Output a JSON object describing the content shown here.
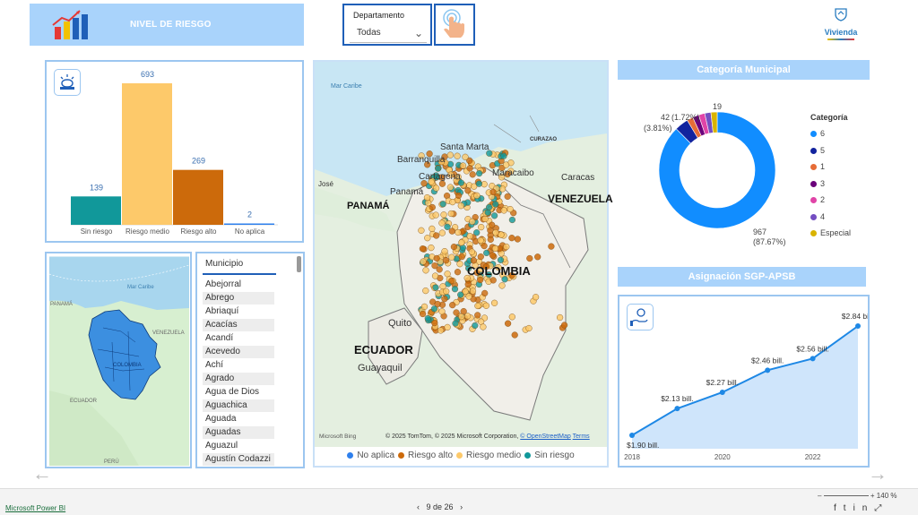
{
  "header": {
    "title": "NIVEL DE RIESGO",
    "filter_label": "Departamento",
    "filter_value": "Todas",
    "brand": "Vivienda"
  },
  "risk_chart": {
    "chart_data": {
      "type": "bar",
      "categories": [
        "Sin riesgo",
        "Riesgo medio",
        "Riesgo alto",
        "No aplica"
      ],
      "values": [
        139,
        693,
        269,
        2
      ],
      "colors": [
        "#11989a",
        "#fdc96a",
        "#cc6a0b",
        "#2f80ed"
      ]
    }
  },
  "categoria": {
    "title": "Categoría Municipal",
    "legend_title": "Categoría",
    "chart_data": {
      "type": "pie",
      "categories": [
        "6",
        "5",
        "1",
        "3",
        "2",
        "4",
        "Especial"
      ],
      "values": [
        967,
        42,
        19,
        19,
        19,
        19,
        19
      ],
      "colors": [
        "#118dff",
        "#12239e",
        "#e66c37",
        "#6b007b",
        "#e044a7",
        "#744ec2",
        "#d9b300"
      ]
    },
    "labels": {
      "big_value": "967",
      "big_pct": "(87.67%)",
      "a_value": "42",
      "a_pct": "(3.81%)",
      "b_value": "19",
      "b_pct": "(1.72%)"
    }
  },
  "sgp": {
    "title": "Asignación SGP-APSB",
    "chart_data": {
      "type": "area",
      "x": [
        2018,
        2019,
        2020,
        2021,
        2022,
        2023
      ],
      "values": [
        1.9,
        2.13,
        2.27,
        2.46,
        2.56,
        2.84
      ],
      "data_labels": [
        "$1.90 bill.",
        "$2.13 bill.",
        "$2.27 bill.",
        "$2.46 bill.",
        "$2.56 bill.",
        "$2.84 bill."
      ],
      "x_ticks": [
        "2018",
        "2020",
        "2022"
      ],
      "color": "#1e88e5"
    }
  },
  "municipios": {
    "header": "Municipio",
    "items": [
      "Abejorral",
      "Abrego",
      "Abriaquí",
      "Acacías",
      "Acandí",
      "Acevedo",
      "Achí",
      "Agrado",
      "Agua de Dios",
      "Aguachica",
      "Aguada",
      "Aguadas",
      "Aguazul",
      "Agustín Codazzi"
    ]
  },
  "map": {
    "labels": [
      "Mar Caribe",
      "Santa Marta",
      "CURAZAO",
      "Barranquilla",
      "Cartagena",
      "Maracaibo",
      "Caracas",
      "José",
      "Panamá",
      "PANAMÁ",
      "VENEZUELA",
      "COLOMBIA",
      "Quito",
      "ECUADOR",
      "Guayaquil"
    ],
    "attribution": "© 2025 TomTom, © 2025 Microsoft Corporation,",
    "osm": "© OpenStreetMap",
    "terms": "Terms",
    "bing": "Microsoft Bing",
    "legend": [
      "No aplica",
      "Riesgo alto",
      "Riesgo medio",
      "Sin riesgo"
    ],
    "legend_colors": [
      "#2f80ed",
      "#cc6a0b",
      "#fdc96a",
      "#11989a"
    ]
  },
  "minimap": {
    "labels": [
      "Mar Caribe",
      "PANAMÁ",
      "VENEZUELA",
      "COLOMBIA",
      "ECUADOR",
      "PERÚ"
    ]
  },
  "footer": {
    "brand": "Microsoft Power BI",
    "page": "9 de 26",
    "zoom": "140 %"
  }
}
